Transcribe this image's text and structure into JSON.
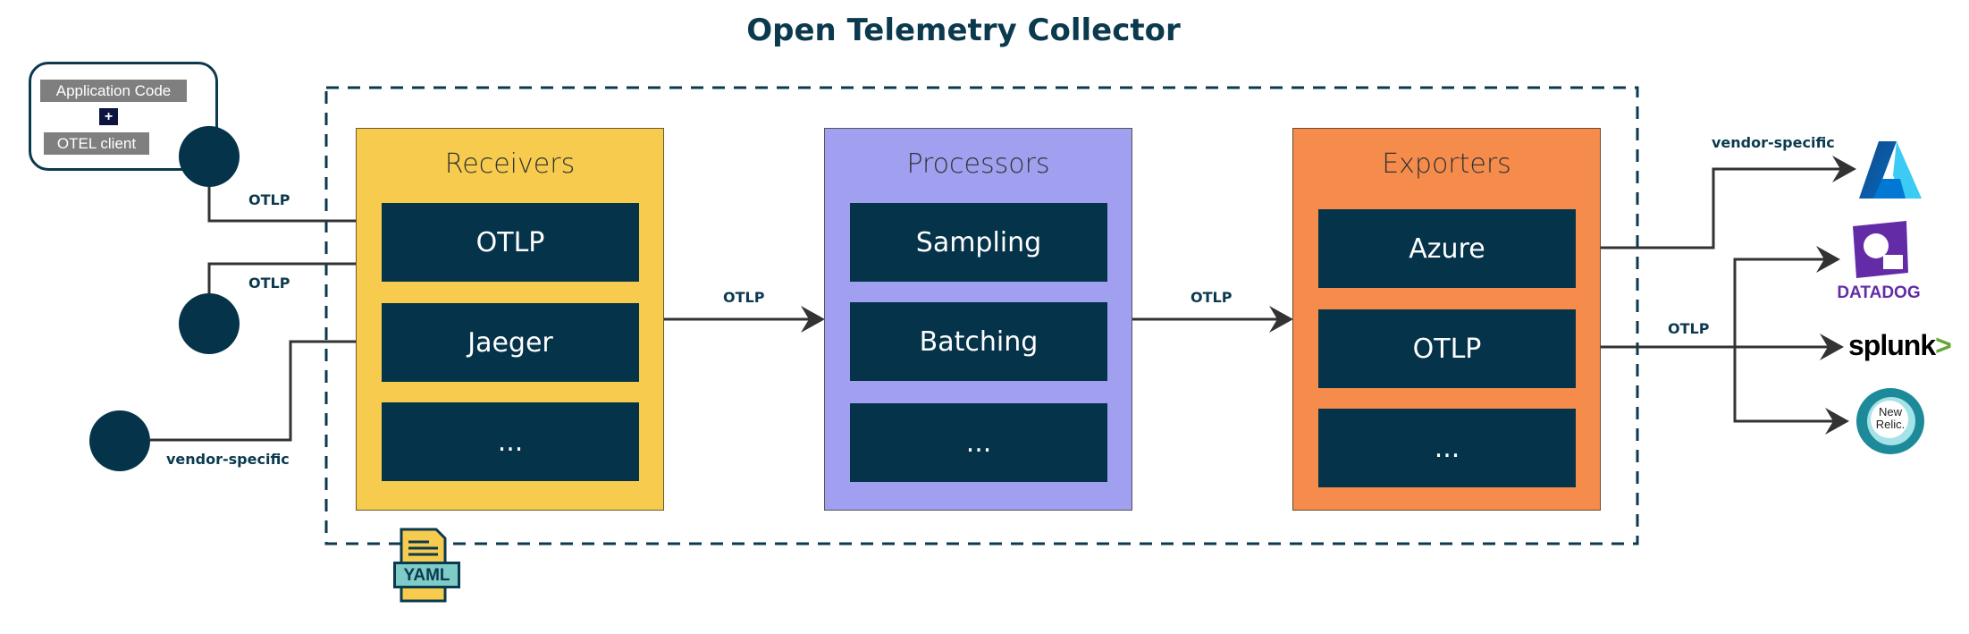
{
  "title": "Open Telemetry Collector",
  "app": {
    "code_label": "Application Code",
    "plus": "+",
    "client_label": "OTEL client"
  },
  "panels": {
    "receivers": {
      "title": "Receivers",
      "items": [
        "OTLP",
        "Jaeger",
        "..."
      ],
      "color": "#f7cb4d"
    },
    "processors": {
      "title": "Processors",
      "items": [
        "Sampling",
        "Batching",
        "..."
      ],
      "color": "#a09ff0"
    },
    "exporters": {
      "title": "Exporters",
      "items": [
        "Azure",
        "OTLP",
        "..."
      ],
      "color": "#f58c4c"
    }
  },
  "flows": {
    "in1": "OTLP",
    "in2": "OTLP",
    "in3": "vendor-specific",
    "recv_proc": "OTLP",
    "proc_exp": "OTLP",
    "out_azure": "vendor-specific",
    "out_otlp": "OTLP"
  },
  "config": {
    "file_label": "YAML"
  },
  "vendors": {
    "azure": "Azure",
    "datadog": "DATADOG",
    "splunk": "splunk",
    "newrelic_line1": "New",
    "newrelic_line2": "Relic."
  },
  "colors": {
    "navy": "#05334a",
    "arrow": "#333333"
  }
}
